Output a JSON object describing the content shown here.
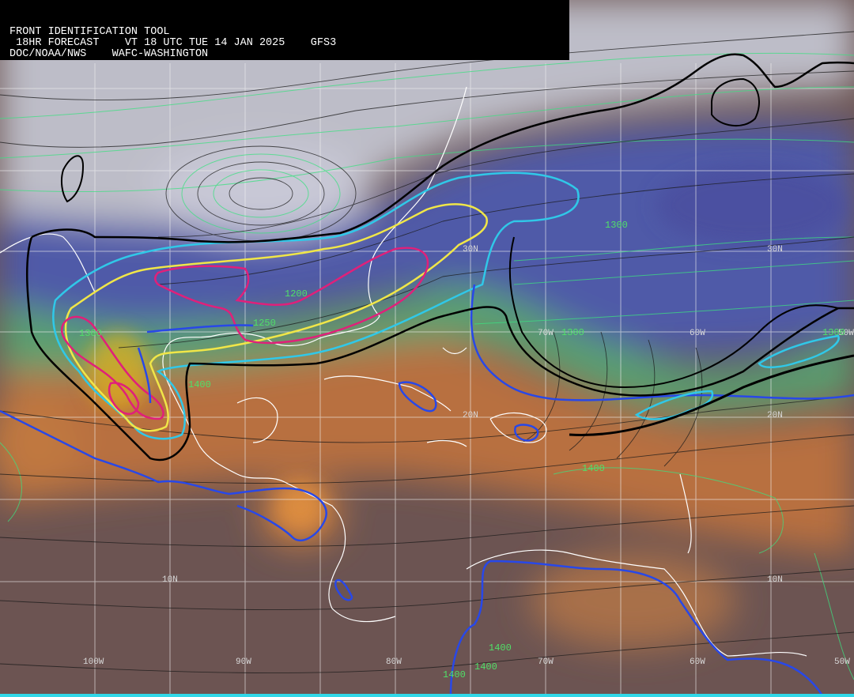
{
  "header": {
    "line1": "FRONT IDENTIFICATION TOOL",
    "line2": " 18HR FORECAST    VT 18 UTC TUE 14 JAN 2025    GFS3",
    "line3": "DOC/NOAA/NWS    WAFC-WASHINGTON"
  },
  "grid_labels": {
    "lat": [
      "30N",
      "30N",
      "20N",
      "20N",
      "10N",
      "10N"
    ],
    "lon": [
      "100W",
      "90W",
      "80W",
      "70W",
      "60W",
      "50W",
      "70W",
      "60W",
      "50W"
    ]
  },
  "contour_labels": [
    "1200",
    "1250",
    "1300",
    "1400",
    "1400",
    "1400",
    "1400",
    "1400",
    "1300",
    "1300",
    "1300"
  ],
  "colors": {
    "cold_air": "#b8b8c8",
    "frontal_blue": "#5060a8",
    "transition_green": "#58a070",
    "warm_orange": "#c87838",
    "tropical_brown": "#6e5652",
    "contour_magenta": "#e0207a",
    "contour_yellow": "#f0e040",
    "contour_cyan": "#30c0e0",
    "contour_blue": "#2040e0",
    "front_black": "#000000",
    "coastline": "#ffffff",
    "isobar_green": "#40e080"
  }
}
